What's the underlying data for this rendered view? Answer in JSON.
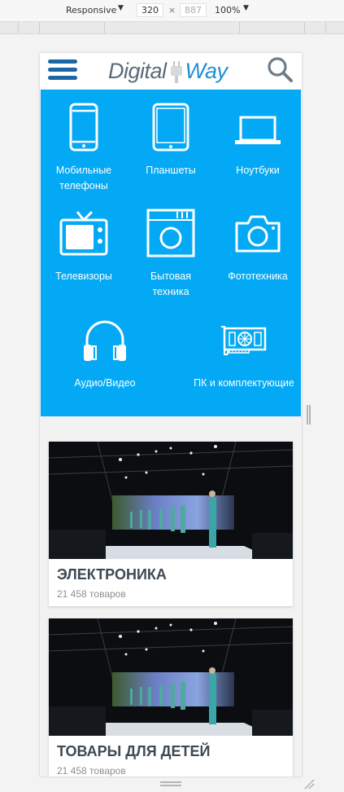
{
  "devtools": {
    "device_mode": "Responsive",
    "width": "320",
    "height": "887",
    "zoom": "100%",
    "dropdown_icon": "triangle-down-icon"
  },
  "header": {
    "menu_icon": "hamburger-icon",
    "logo_part1": "Digital",
    "logo_part2": "Way",
    "search_icon": "search-icon",
    "brand_colors": {
      "dark": "#1a66a6",
      "grey": "#5b6b79",
      "blue": "#1e8fd6"
    }
  },
  "categories": {
    "background": "#03a9f4",
    "items": [
      {
        "label": "Мобильные телефоны",
        "icon": "mobile-phone-icon"
      },
      {
        "label": "Планшеты",
        "icon": "tablet-icon"
      },
      {
        "label": "Ноутбуки",
        "icon": "laptop-icon"
      },
      {
        "label": "Телевизоры",
        "icon": "tv-icon"
      },
      {
        "label": "Бытовая техника",
        "icon": "washing-machine-icon"
      },
      {
        "label": "Фототехника",
        "icon": "camera-icon"
      },
      {
        "label": "Аудио/Видео",
        "icon": "headphones-icon"
      },
      {
        "label": "ПК и комплектующие",
        "icon": "graphics-card-icon"
      }
    ]
  },
  "cards": [
    {
      "title": "ЭЛЕКТРОНИКА",
      "count": "21 458 товаров",
      "image": "fashion-runway-photo"
    },
    {
      "title": "ТОВАРЫ ДЛЯ ДЕТЕЙ",
      "count": "21 458 товаров",
      "image": "fashion-runway-photo"
    }
  ]
}
